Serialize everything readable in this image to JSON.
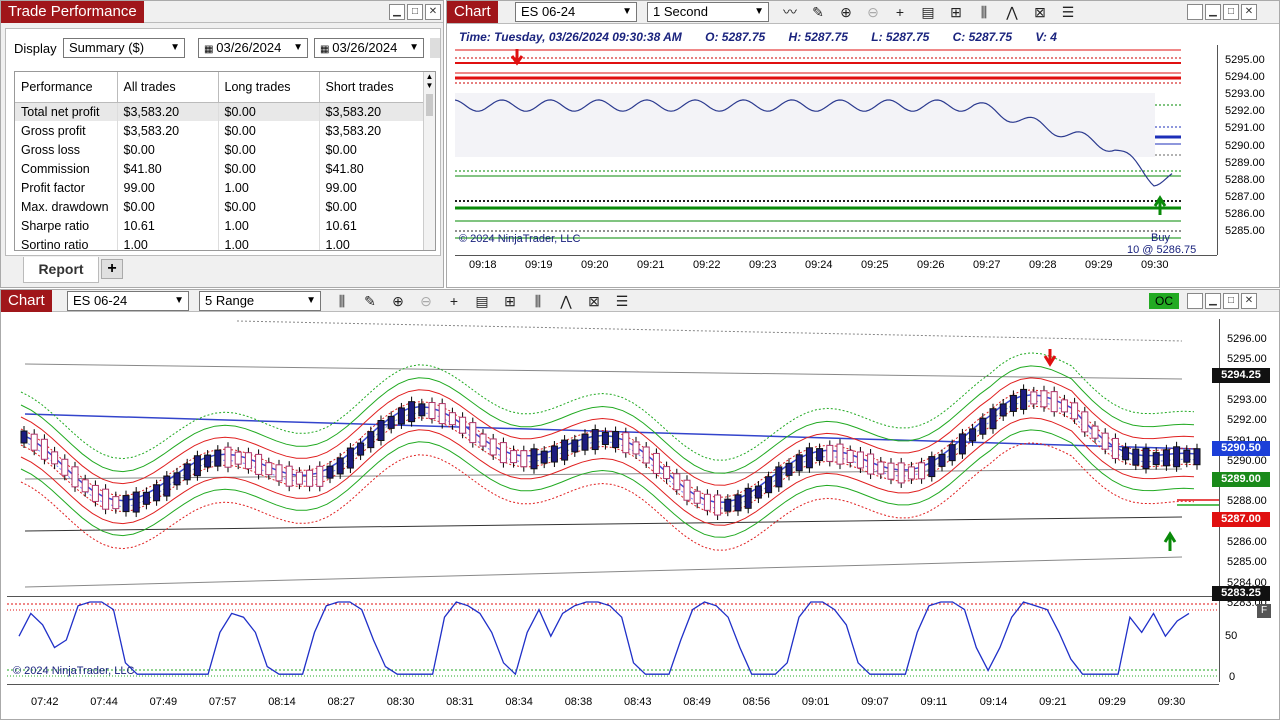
{
  "trade_perf": {
    "title": "Trade Performance",
    "display_label": "Display",
    "display_value": "Summary ($)",
    "date_from": "03/26/2024",
    "date_to": "03/26/2024",
    "columns": [
      "Performance",
      "All trades",
      "Long trades",
      "Short trades"
    ],
    "rows": [
      [
        "Total net profit",
        "$3,583.20",
        "$0.00",
        "$3,583.20"
      ],
      [
        "Gross profit",
        "$3,583.20",
        "$0.00",
        "$3,583.20"
      ],
      [
        "Gross loss",
        "$0.00",
        "$0.00",
        "$0.00"
      ],
      [
        "Commission",
        "$41.80",
        "$0.00",
        "$41.80"
      ],
      [
        "Profit factor",
        "99.00",
        "1.00",
        "99.00"
      ],
      [
        "Max. drawdown",
        "$0.00",
        "$0.00",
        "$0.00"
      ],
      [
        "Sharpe ratio",
        "10.61",
        "1.00",
        "10.61"
      ],
      [
        "Sortino ratio",
        "1.00",
        "1.00",
        "1.00"
      ]
    ],
    "tab_label": "Report",
    "add_tab": "+"
  },
  "chart1": {
    "title": "Chart",
    "instrument": "ES 06-24",
    "interval": "1 Second",
    "info": {
      "time": "Time: Tuesday, 03/26/2024 09:30:38 AM",
      "open": "O: 5287.75",
      "high": "H: 5287.75",
      "low": "L: 5287.75",
      "close": "C: 5287.75",
      "volume": "V: 4"
    },
    "copyright": "© 2024 NinjaTrader, LLC",
    "buy_label": "Buy",
    "buy_fill": "10 @ 5286.75",
    "y_ticks": [
      "5295.00",
      "5294.00",
      "5293.00",
      "5292.00",
      "5291.00",
      "5290.00",
      "5289.00",
      "5288.00",
      "5287.00",
      "5286.00",
      "5285.00"
    ],
    "x_ticks": [
      "09:18",
      "09:19",
      "09:20",
      "09:21",
      "09:22",
      "09:23",
      "09:24",
      "09:25",
      "09:26",
      "09:27",
      "09:28",
      "09:29",
      "09:30"
    ]
  },
  "chart2": {
    "title": "Chart",
    "instrument": "ES 06-24",
    "interval": "5 Range",
    "oc_label": "OC",
    "copyright": "© 2024 NinjaTrader, LLC",
    "y_ticks": [
      "5296.00",
      "5295.00",
      "5294.00",
      "5293.00",
      "5292.00",
      "5291.00",
      "5290.00",
      "5289.00",
      "5288.00",
      "5287.00",
      "5286.00",
      "5285.00",
      "5284.00",
      "5283.00"
    ],
    "price_tags": {
      "a": "5294.25",
      "b": "5290.50",
      "c": "5289.00",
      "d": "5287.00",
      "e": "5283.25"
    },
    "osc_ticks": [
      "50",
      "0"
    ],
    "x_ticks": [
      "07:42",
      "07:44",
      "07:49",
      "07:57",
      "08:14",
      "08:27",
      "08:30",
      "08:31",
      "08:34",
      "08:38",
      "08:43",
      "08:49",
      "08:56",
      "09:01",
      "09:07",
      "09:11",
      "09:14",
      "09:21",
      "09:29",
      "09:30"
    ],
    "osc_values": [
      55,
      85,
      70,
      40,
      50,
      95,
      100,
      100,
      90,
      20,
      5,
      5,
      5,
      5,
      5,
      5,
      5,
      60,
      85,
      80,
      60,
      15,
      5,
      5,
      5,
      60,
      95,
      100,
      100,
      90,
      50,
      15,
      5,
      5,
      5,
      5,
      80,
      100,
      95,
      85,
      60,
      20,
      5,
      60,
      90,
      55,
      85,
      95,
      100,
      100,
      95,
      80,
      20,
      5,
      5,
      5,
      50,
      90,
      100,
      95,
      80,
      40,
      5,
      5,
      5,
      20,
      80,
      100,
      100,
      90,
      70,
      20,
      5,
      5,
      5,
      5,
      60,
      95,
      100,
      100,
      90,
      40,
      10,
      40,
      80,
      100,
      95,
      90,
      60,
      25,
      5,
      5,
      5,
      5,
      80,
      60,
      85,
      55,
      75,
      85
    ]
  },
  "colors": {
    "brand": "#a0161a",
    "blue_line": "#1c2fb8",
    "red_line": "#e01010",
    "green_line": "#0a8a0a",
    "oc_green": "#22aa22"
  }
}
